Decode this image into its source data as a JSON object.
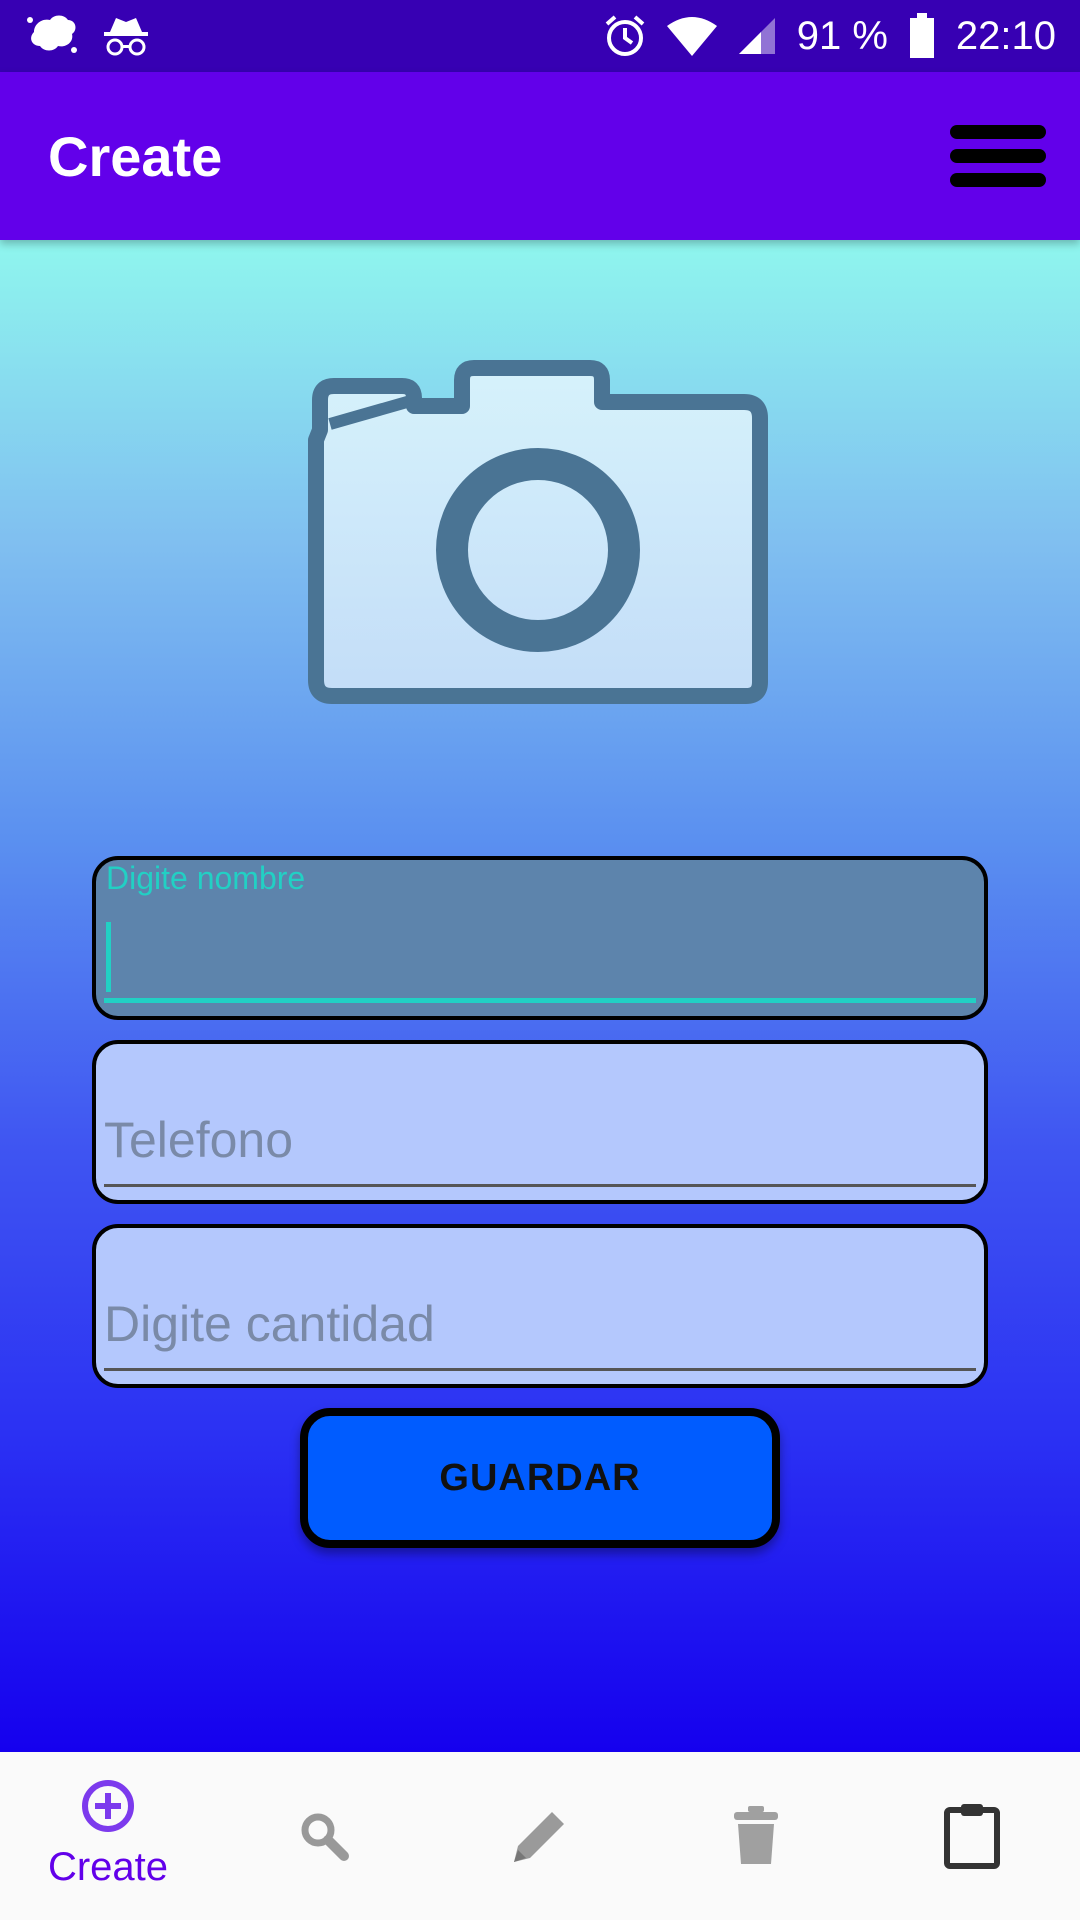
{
  "status_bar": {
    "battery_text": "91 %",
    "time": "22:10",
    "icons": [
      "blob-notification-icon",
      "incognito-icon",
      "alarm-icon",
      "wifi-icon",
      "cell-signal-icon",
      "battery-icon"
    ]
  },
  "app_bar": {
    "title": "Create",
    "menu_icon": "menu-icon"
  },
  "form": {
    "photo_icon": "camera-icon",
    "name_label": "Digite nombre",
    "name_value": "",
    "phone_placeholder": "Telefono",
    "quantity_placeholder": "Digite cantidad",
    "save_label": "GUARDAR"
  },
  "bottom_nav": {
    "items": [
      {
        "label": "Create",
        "icon": "add-circle-icon",
        "active": true
      },
      {
        "label": "",
        "icon": "search-icon",
        "active": false
      },
      {
        "label": "",
        "icon": "pencil-icon",
        "active": false
      },
      {
        "label": "",
        "icon": "trash-icon",
        "active": false
      },
      {
        "label": "",
        "icon": "clipboard-icon",
        "active": false
      }
    ]
  },
  "colors": {
    "status_bar": "#3700b3",
    "app_bar": "#6200ea",
    "accent": "#22d0c4",
    "button": "#005cff",
    "nav_active": "#6200ea"
  }
}
